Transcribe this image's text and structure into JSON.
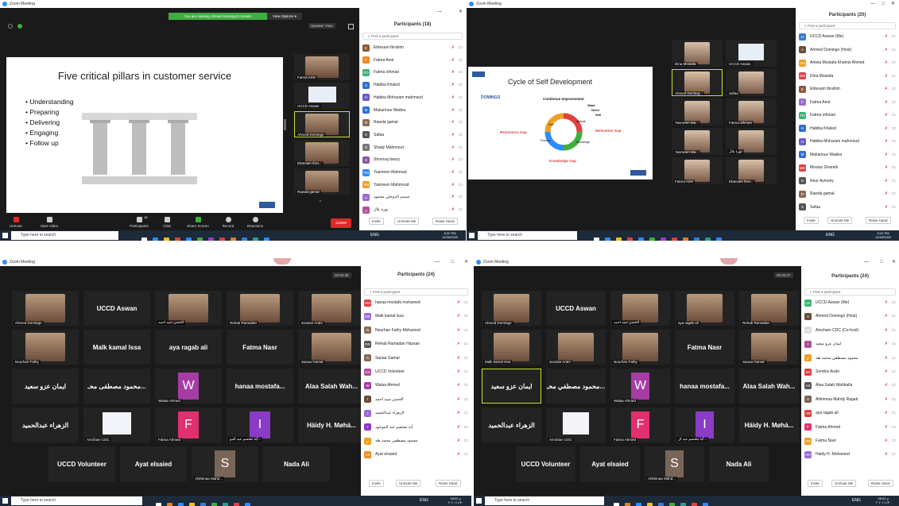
{
  "app_title": "Zoom Meeting",
  "q1": {
    "banner": "You are viewing Ahmed Domingo's screen",
    "view_options": "View Options ▾",
    "speaker_view": "Speaker View",
    "slide_title": "Five critical pillars in customer service",
    "bullets": [
      "Understanding",
      "Preparing",
      "Delivering",
      "Engaging",
      "Follow up"
    ],
    "tiles": [
      "Fatma Amir",
      "UCCD Aswan",
      "Ahmed Domingo",
      "Ebtesam Ibra...",
      "Rawda gamal"
    ],
    "panel_title": "Participants (18)",
    "participants": [
      {
        "n": "Ebtesam Ibrahim",
        "i": "E",
        "c": "#8b5a3c"
      },
      {
        "n": "Fatma Amir",
        "i": "F",
        "c": "#f08a24"
      },
      {
        "n": "Fatma othman",
        "i": "FO",
        "c": "#3cb371"
      },
      {
        "n": "Habiba Khaled",
        "i": "H",
        "c": "#2d6fd6"
      },
      {
        "n": "Habiba Moharam mahmoud",
        "i": "H",
        "c": "#6a5acd"
      },
      {
        "n": "Makarious Wadea",
        "i": "M",
        "c": "#2d6fd6"
      },
      {
        "n": "Rawda gamal",
        "i": "R",
        "c": "#8b6b55"
      },
      {
        "n": "Safaa",
        "i": "S",
        "c": "#555"
      },
      {
        "n": "Shady Mahmoud",
        "i": "S",
        "c": "#777"
      },
      {
        "n": "Shorouq fawzy",
        "i": "S",
        "c": "#8a5a9a"
      },
      {
        "n": "Yasmeen Mahmad",
        "i": "YM",
        "c": "#2d8cff"
      },
      {
        "n": "Yasmeen Mahmoud",
        "i": "YM",
        "c": "#f0a020"
      },
      {
        "n": "تسنيم الدوخلي محمود",
        "i": "ت",
        "c": "#9b6bd6"
      },
      {
        "n": "نورة بلال",
        "i": "ن",
        "c": "#b0509a"
      }
    ],
    "footer": [
      "Invite",
      "Unmute Me",
      "Raise Hand"
    ],
    "toolbar": [
      "Unmute",
      "Start Video",
      "Participants",
      "Chat",
      "Share Screen",
      "Record",
      "Reactions"
    ],
    "participants_count": "18",
    "leave": "Leave",
    "time": "5:20 PM",
    "date": "11/30/2020"
  },
  "q2": {
    "slide_title": "Cycle of Self Development",
    "labels": [
      "Continous Improvement",
      "Want",
      "Need",
      "Will",
      "Attitude",
      "Motivation Gap",
      "Knowledge",
      "Knowledge Gap",
      "Practice",
      "Skill",
      "Resistance Gap"
    ],
    "tiles": [
      "Dina Mostafa",
      "UCCD Aswan",
      "Ahmed Doming...",
      "Safaa",
      "Yasmeen Ma...",
      "Fatma othman",
      "Yasmeen Ma...",
      "نورة بلال",
      "Fatma Amir",
      "Ebtesam Ibra..."
    ],
    "panel_title": "Participants (20)",
    "participants": [
      {
        "n": "UCCD Aswan (Me)",
        "i": "U",
        "c": "#3a7bd5"
      },
      {
        "n": "Ahmed Domingo (Host)",
        "i": "A",
        "c": "#6b4c3b"
      },
      {
        "n": "Amina Mostafa Khamis Ahmed",
        "i": "AM",
        "c": "#f0a020"
      },
      {
        "n": "Dina Mostafa",
        "i": "DM",
        "c": "#e04040"
      },
      {
        "n": "Ebtesam Ibrahim",
        "i": "E",
        "c": "#8b5a3c"
      },
      {
        "n": "Fatma Amir",
        "i": "F",
        "c": "#9b6bd6"
      },
      {
        "n": "Fatma othman",
        "i": "FO",
        "c": "#3cb371"
      },
      {
        "n": "Habiba Khaled",
        "i": "H",
        "c": "#2d6fd6"
      },
      {
        "n": "Habiba Moharam mahmoud",
        "i": "H",
        "c": "#6a5acd"
      },
      {
        "n": "Makarious Wadea",
        "i": "M",
        "c": "#2d6fd6"
      },
      {
        "n": "Mostaz Ghareib",
        "i": "MG",
        "c": "#e04040"
      },
      {
        "n": "Nour Aymony",
        "i": "N",
        "c": "#555"
      },
      {
        "n": "Rawda gamal",
        "i": "R",
        "c": "#8b6b55"
      },
      {
        "n": "Safaa",
        "i": "S",
        "c": "#555"
      }
    ],
    "footer": [
      "Invite",
      "Unmute Me",
      "Raise Hand"
    ],
    "time": "5:41 PM",
    "date": "11/30/2020"
  },
  "q3": {
    "timer": "00:00:38",
    "tiles": [
      {
        "n": "Ahmed Domingo",
        "t": "photo"
      },
      {
        "n": "UCCD Aswan",
        "t": "text"
      },
      {
        "n": "الحسن سيد احمد",
        "t": "photo"
      },
      {
        "n": "Rehab Ramadan",
        "t": "photo"
      },
      {
        "n": "Sondos Arabi",
        "t": "photo"
      },
      {
        "n": "Nourhan Fathy",
        "t": "photo"
      },
      {
        "n": "Malk kamal Issa",
        "t": "text"
      },
      {
        "n": "aya ragab ali",
        "t": "text"
      },
      {
        "n": "Fatma Nasr",
        "t": "text"
      },
      {
        "n": "Sanaa Gamal",
        "t": "photo"
      },
      {
        "n": "ايمان عزو سعيد",
        "t": "text"
      },
      {
        "n": "محمود مصطفى محـ...",
        "t": "text"
      },
      {
        "n": "Walaa Ahmed",
        "t": "W",
        "c": "#a63ca6"
      },
      {
        "n": "hanaa mostafa...",
        "t": "text"
      },
      {
        "n": "Alaa Salah Wah...",
        "t": "text"
      },
      {
        "n": "الزهراء عبدالحميد",
        "t": "text"
      },
      {
        "n": "Amcham CDC",
        "t": "logo"
      },
      {
        "n": "Fatma Ahmed",
        "t": "F",
        "c": "#e03070"
      },
      {
        "n": "آية معتصم عبد المو...",
        "t": "I",
        "c": "#8a3cc6"
      },
      {
        "n": "Häidy H. Møhá...",
        "t": "text"
      },
      {
        "n": "UCCD Volunteer",
        "t": "text"
      },
      {
        "n": "Ayat elsaied",
        "t": "text"
      },
      {
        "n": "Afshimaa Mahd...",
        "t": "S",
        "c": "#7a6658"
      },
      {
        "n": "Nada Ali",
        "t": "text"
      }
    ],
    "panel_title": "Participants (24)",
    "participants": [
      {
        "n": "hanaa mostafa mohamed",
        "i": "HM",
        "c": "#e04040"
      },
      {
        "n": "Malk kamal Issa",
        "i": "MK",
        "c": "#9b6bd6"
      },
      {
        "n": "Nourhan Fathy Mohamed",
        "i": "N",
        "c": "#8b6b55"
      },
      {
        "n": "Rehab Ramadan Hassan",
        "i": "RR",
        "c": "#555"
      },
      {
        "n": "Sanaa Gamal",
        "i": "S",
        "c": "#8b6b55"
      },
      {
        "n": "UCCD Volunteer",
        "i": "UV",
        "c": "#b0509a"
      },
      {
        "n": "Walaa Ahmed",
        "i": "W",
        "c": "#a63ca6"
      },
      {
        "n": "الحسن سيد احمد",
        "i": "ا",
        "c": "#6b4c3b"
      },
      {
        "n": "الزهراء عبدالحميد",
        "i": "ا",
        "c": "#9b6bd6"
      },
      {
        "n": "آية معتصم عبد الموجود",
        "i": "I",
        "c": "#8a3cc6"
      },
      {
        "n": "محمود مصطفي محمد طه",
        "i": "م",
        "c": "#f0a020"
      },
      {
        "n": "Ayat elsaied",
        "i": "AE",
        "c": "#f08a24"
      }
    ],
    "footer": [
      "Invite",
      "Unmute Me",
      "Raise Hand"
    ],
    "time": "05:02 م",
    "date": "٢٠٢٠/١١/٣٠"
  },
  "q4": {
    "timer": "00:00:27",
    "tiles": [
      {
        "n": "Ahmed Domingo",
        "t": "photo"
      },
      {
        "n": "UCCD Aswan",
        "t": "text"
      },
      {
        "n": "الحسن سيد احمد",
        "t": "photo"
      },
      {
        "n": "aya ragab ali",
        "t": "photo"
      },
      {
        "n": "Rehab Ramadan",
        "t": "photo"
      },
      {
        "n": "Malk kamal Issa",
        "t": "photo"
      },
      {
        "n": "Sondos Arabi",
        "t": "photo"
      },
      {
        "n": "Nourhan Fathy",
        "t": "photo"
      },
      {
        "n": "Fatma Nasr",
        "t": "text"
      },
      {
        "n": "Sanaa Gamal",
        "t": "photo"
      },
      {
        "n": "ايمان عزو سعيد",
        "t": "text"
      },
      {
        "n": "محمود مصطفي محـ...",
        "t": "text"
      },
      {
        "n": "Walaa Ahmed",
        "t": "W",
        "c": "#a63ca6"
      },
      {
        "n": "hanaa mostafa...",
        "t": "text"
      },
      {
        "n": "Alaa Salah Wah...",
        "t": "text"
      },
      {
        "n": "الزهراء عبدالحميد",
        "t": "text"
      },
      {
        "n": "Amcham CDC",
        "t": "logo"
      },
      {
        "n": "Fatma Ahmed",
        "t": "F",
        "c": "#e03070"
      },
      {
        "n": "آية معتصم عبد ال...",
        "t": "I",
        "c": "#8a3cc6"
      },
      {
        "n": "Häidy H. Møhá...",
        "t": "text"
      },
      {
        "n": "UCCD Volunteer",
        "t": "text"
      },
      {
        "n": "Ayat elsaied",
        "t": "text"
      },
      {
        "n": "Afshimaa Mahd...",
        "t": "S",
        "c": "#7a6658"
      },
      {
        "n": "Nada Ali",
        "t": "text"
      }
    ],
    "panel_title": "Participants (24)",
    "participants": [
      {
        "n": "UCCD Aswan (Me)",
        "i": "UA",
        "c": "#3cb371"
      },
      {
        "n": "Ahmed Domingo (Host)",
        "i": "A",
        "c": "#6b4c3b"
      },
      {
        "n": "Amcham CDC (Co-host)",
        "i": "a",
        "c": "#ddd"
      },
      {
        "n": "ايمان عزو سعيد",
        "i": "I",
        "c": "#b0509a"
      },
      {
        "n": "محمود مصطفي محمد طه",
        "i": "م",
        "c": "#f0a020"
      },
      {
        "n": "Sondos Arabi",
        "i": "SA",
        "c": "#e04040"
      },
      {
        "n": "Alaa Salah Wahballa",
        "i": "AS",
        "c": "#555"
      },
      {
        "n": "Afshimaa Mahdy Ragab",
        "i": "A",
        "c": "#7a6658"
      },
      {
        "n": "aya ragab ali",
        "i": "AR",
        "c": "#e04040"
      },
      {
        "n": "Fatma Ahmed",
        "i": "F",
        "c": "#e03070"
      },
      {
        "n": "Fatma Nasr",
        "i": "FN",
        "c": "#f0a020"
      },
      {
        "n": "Häidy H. Mohamed",
        "i": "HH",
        "c": "#9b6bd6"
      }
    ],
    "footer": [
      "Invite",
      "Unmute Me",
      "Raise Hand"
    ],
    "time": "05:02 م",
    "date": "٢٠٢٠/١١/٣٠"
  },
  "taskbar": {
    "search_placeholder": "Type here to search",
    "lang": "ENG"
  },
  "colors": {
    "zoom_blue": "#2d8cff",
    "active_speaker": "#c6e02f",
    "mic_muted": "#e02828",
    "taskbar": "#1d2a3a"
  }
}
